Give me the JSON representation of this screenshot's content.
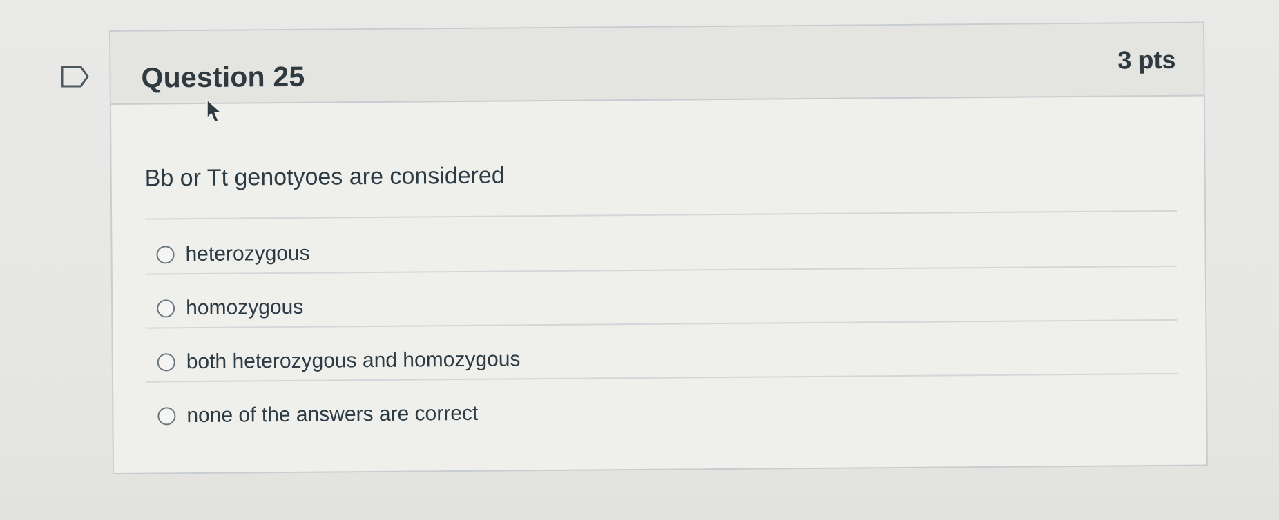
{
  "question": {
    "title": "Question 25",
    "points": "3 pts",
    "text": "Bb or Tt genotyoes are considered",
    "answers": [
      {
        "label": "heterozygous"
      },
      {
        "label": "homozygous"
      },
      {
        "label": "both heterozygous and homozygous"
      },
      {
        "label": "none of the answers are correct"
      }
    ]
  },
  "icons": {
    "flag": "flag-question-icon",
    "cursor": "mouse-pointer-icon"
  },
  "colors": {
    "header_bg": "#e4e4e1",
    "card_bg": "#efefec",
    "border": "#c7cdd1",
    "text": "#2d3b45"
  }
}
